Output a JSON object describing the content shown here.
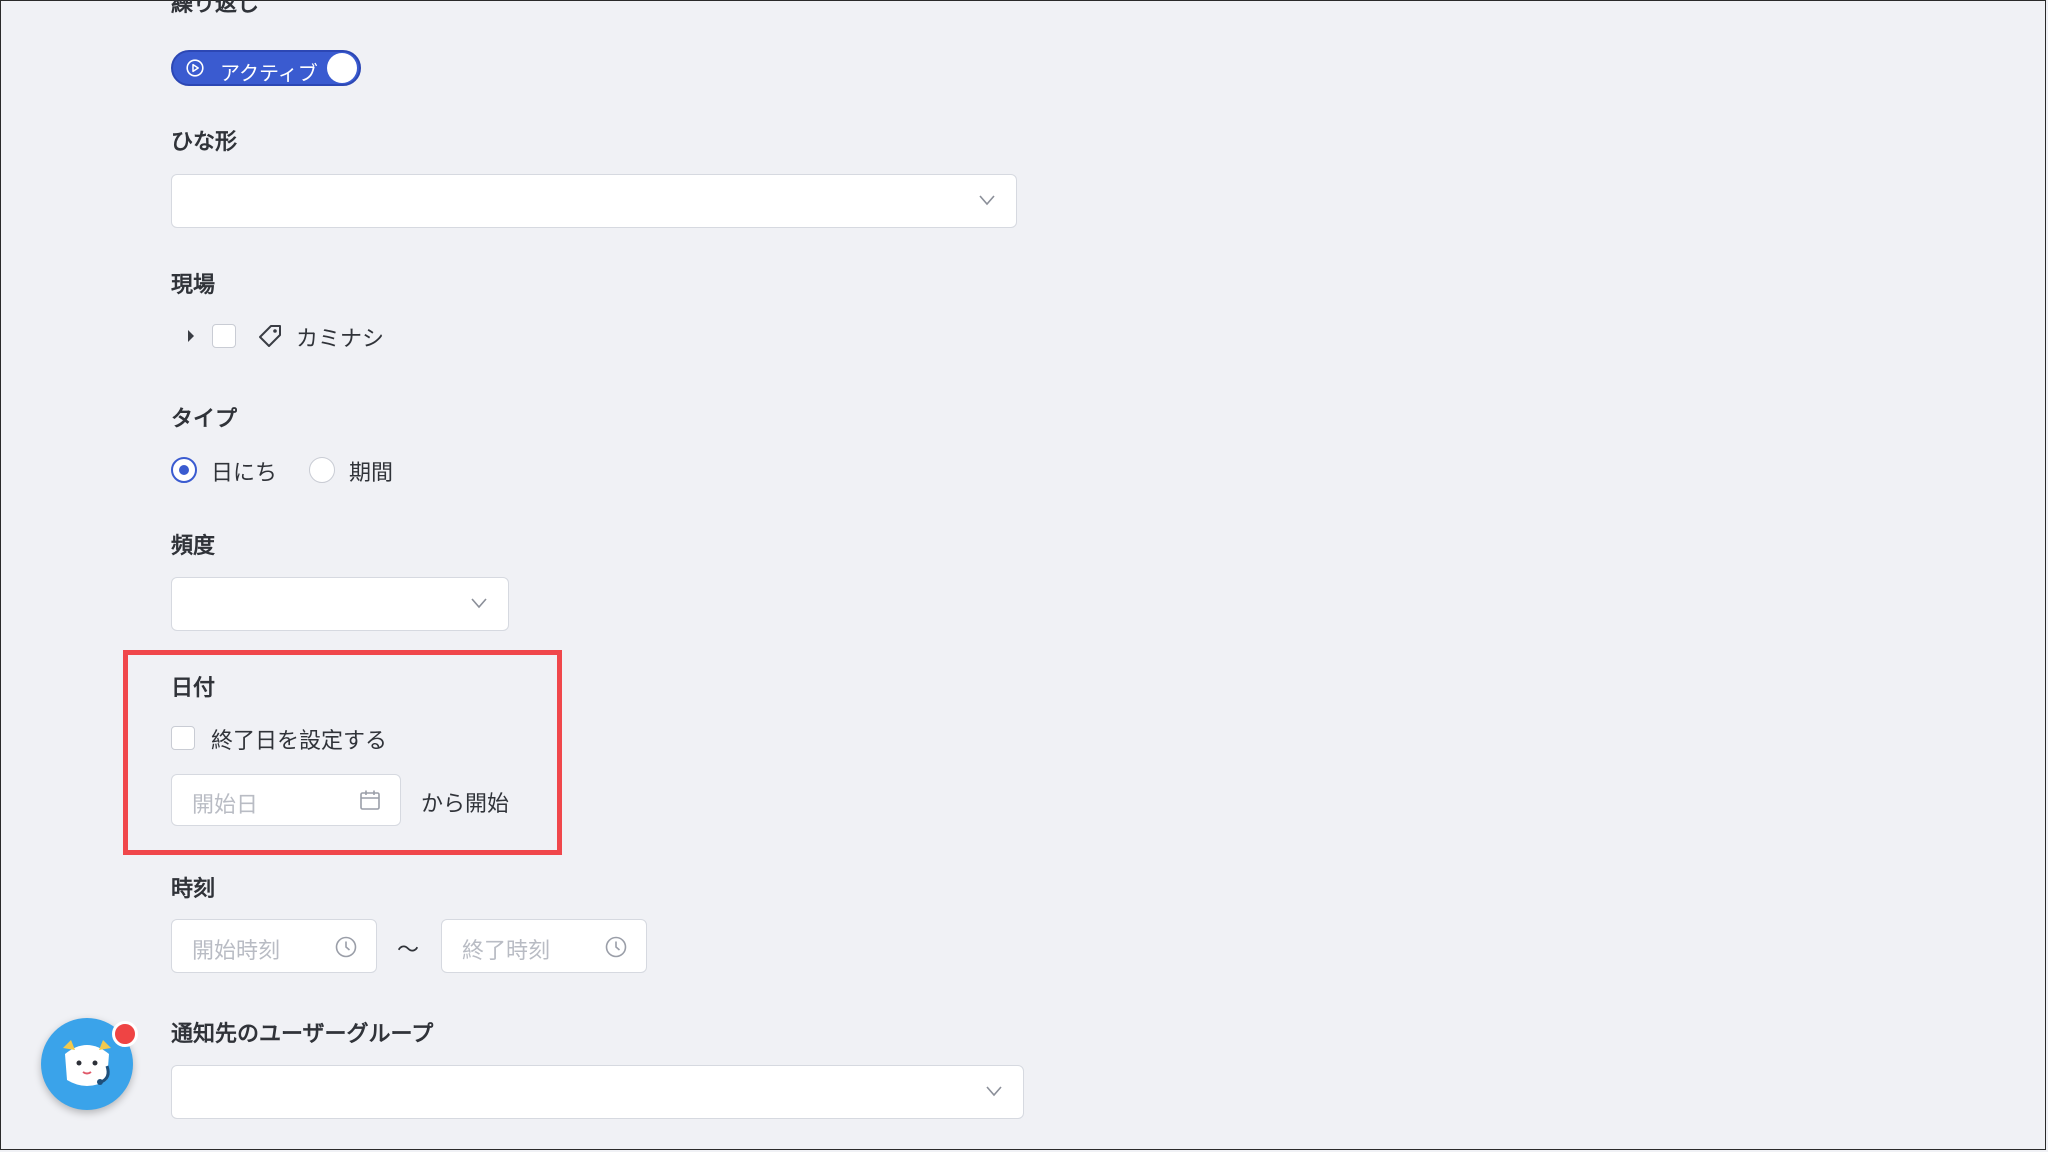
{
  "form": {
    "cut_label": "繰り返し",
    "status_toggle": {
      "label": "アクティブ",
      "on": true
    },
    "template": {
      "label": "ひな形",
      "value": ""
    },
    "site": {
      "label": "現場",
      "tree_item": "カミナシ"
    },
    "type": {
      "label": "タイプ",
      "options": [
        "日にち",
        "期間"
      ],
      "selected": "日にち"
    },
    "frequency": {
      "label": "頻度",
      "value": ""
    },
    "date": {
      "label": "日付",
      "end_date_checkbox": "終了日を設定する",
      "start_placeholder": "開始日",
      "suffix": "から開始"
    },
    "time": {
      "label": "時刻",
      "start_placeholder": "開始時刻",
      "separator": "〜",
      "end_placeholder": "終了時刻"
    },
    "notify_group": {
      "label": "通知先のユーザーグループ",
      "value": ""
    }
  },
  "colors": {
    "accent": "#3a5bd0",
    "highlight": "#f0474b",
    "background": "#f0f1f5",
    "chat_bot": "#3aa3ea",
    "notification": "#ef4444"
  },
  "icons": [
    "play-circle-icon",
    "chevron-down-icon",
    "caret-right-icon",
    "tag-icon",
    "calendar-icon",
    "clock-icon",
    "chat-bot-icon"
  ]
}
